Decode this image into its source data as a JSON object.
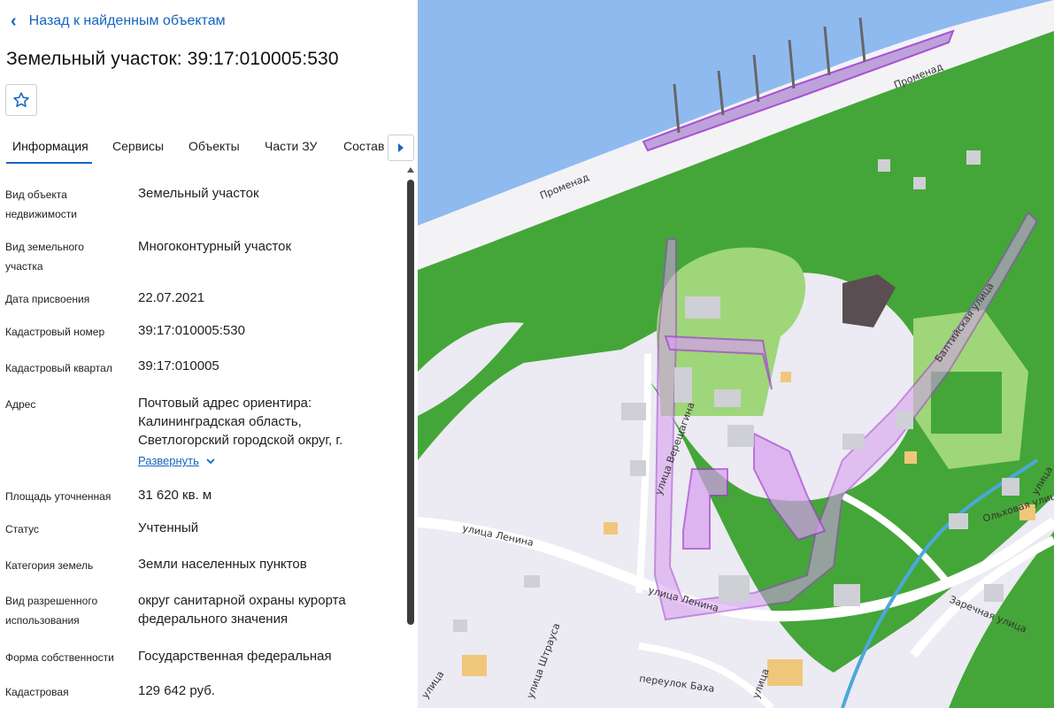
{
  "back": {
    "label": "Назад к найденным объектам"
  },
  "title": "Земельный участок: 39:17:010005:530",
  "tabs": [
    {
      "label": "Информация",
      "active": true
    },
    {
      "label": "Сервисы"
    },
    {
      "label": "Объекты"
    },
    {
      "label": "Части ЗУ"
    },
    {
      "label": "Состав"
    }
  ],
  "properties": [
    {
      "label": "Вид объекта недвижимости",
      "value": "Земельный участок"
    },
    {
      "label": "Вид земельного участка",
      "value": "Многоконтурный участок"
    },
    {
      "label": "Дата присвоения",
      "value": "22.07.2021"
    },
    {
      "label": "Кадастровый номер",
      "value": "39:17:010005:530"
    },
    {
      "label": "Кадастровый квартал",
      "value": "39:17:010005"
    },
    {
      "label": "Адрес",
      "value": "Почтовый адрес ориентира: Калининградская область, Светлогорский городской округ, г."
    },
    {
      "label": "Площадь уточненная",
      "value": "31 620 кв. м"
    },
    {
      "label": "Статус",
      "value": "Учтенный"
    },
    {
      "label": "Категория земель",
      "value": "Земли населенных пунктов"
    },
    {
      "label": "Вид разрешенного использования",
      "value": "округ санитарной охраны курорта федерального значения"
    },
    {
      "label": "Форма собственности",
      "value": "Государственная федеральная"
    },
    {
      "label": "Кадастровая",
      "value": "129 642 руб."
    }
  ],
  "expand_label": "Развернуть",
  "map": {
    "labels": {
      "promenad1": "Променад",
      "promenad2": "Променад",
      "baltiyskaya": "Балтийская улица",
      "lenina1": "улица Ленина",
      "lenina2": "улица Ленина",
      "vereshchagina": "улица Верещагина",
      "olkhovaya": "Ольховая улица",
      "zarechnaya": "Заречная улица",
      "bakha": "переулок Баха",
      "shtrausa": "улица Штрауса",
      "ulitsa1": "улица",
      "ulitsa2": "улица",
      "ulitsa3": "улица"
    },
    "colors": {
      "sea": "#8fbaf0",
      "forest": "#44a638",
      "park": "#9fd67a",
      "urban": "#eceaf2",
      "building": "#cfcfd6",
      "parcel": "#a33fd1",
      "parcel_fill": "#d79df0",
      "stream": "#4aa8dc"
    }
  }
}
